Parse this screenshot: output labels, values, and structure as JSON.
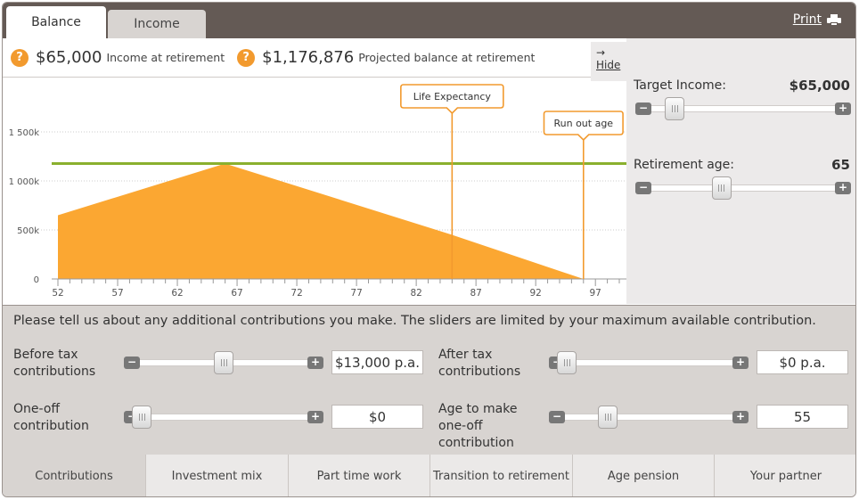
{
  "header": {
    "tabs": [
      {
        "label": "Balance",
        "active": true
      },
      {
        "label": "Income",
        "active": false
      }
    ],
    "print_label": "Print"
  },
  "summary": {
    "income_value": "$65,000",
    "income_label": "Income at retirement",
    "balance_value": "$1,176,876",
    "balance_label": "Projected balance at retirement",
    "hide_arrow": "→",
    "hide_label": "Hide"
  },
  "chart_data": {
    "type": "area",
    "x": [
      52,
      66,
      85,
      96
    ],
    "y": [
      650000,
      1176876,
      450000,
      0
    ],
    "ylim": [
      0,
      1500000
    ],
    "xlim": [
      52,
      99
    ],
    "y_tick_labels": [
      "0",
      "500k",
      "1 000k",
      "1 500k"
    ],
    "y_tick_values": [
      0,
      500000,
      1000000,
      1500000
    ],
    "x_tick_labels": [
      "52",
      "57",
      "62",
      "67",
      "72",
      "77",
      "82",
      "87",
      "92",
      "97"
    ],
    "x_tick_values": [
      52,
      57,
      62,
      67,
      72,
      77,
      82,
      87,
      92,
      97
    ],
    "target_line": 1176876,
    "annotations": [
      {
        "label": "Life Expectancy",
        "x": 85
      },
      {
        "label": "Run out age",
        "x": 96
      }
    ],
    "colors": {
      "area": "#fba732",
      "target": "#8ab02e",
      "callout": "#f29a2e",
      "grid": "#cccccc"
    }
  },
  "right_panel": {
    "target_income_label": "Target Income:",
    "target_income_value": "$65,000",
    "target_income_position": 0.12,
    "retirement_age_label": "Retirement age:",
    "retirement_age_value": "65",
    "retirement_age_position": 0.38
  },
  "contributions": {
    "message": "Please tell us about any additional contributions you make. The sliders are limited by your maximum available contribution.",
    "before_tax_label": "Before tax contributions",
    "before_tax_value": "$13,000 p.a.",
    "before_tax_position": 0.5,
    "after_tax_label": "After tax contributions",
    "after_tax_value": "$0 p.a.",
    "after_tax_position": 0.0,
    "one_off_label": "One-off contribution",
    "one_off_value": "$0",
    "one_off_position": 0.0,
    "age_one_off_label": "Age to make one-off contribution",
    "age_one_off_value": "55",
    "age_one_off_position": 0.25
  },
  "bottom_tabs": [
    {
      "label": "Contributions",
      "active": true
    },
    {
      "label": "Investment mix",
      "active": false
    },
    {
      "label": "Part time work",
      "active": false
    },
    {
      "label": "Transition to retirement",
      "active": false
    },
    {
      "label": "Age pension",
      "active": false
    },
    {
      "label": "Your partner",
      "active": false
    }
  ],
  "slider_controls": {
    "minus": "−",
    "plus": "+"
  }
}
